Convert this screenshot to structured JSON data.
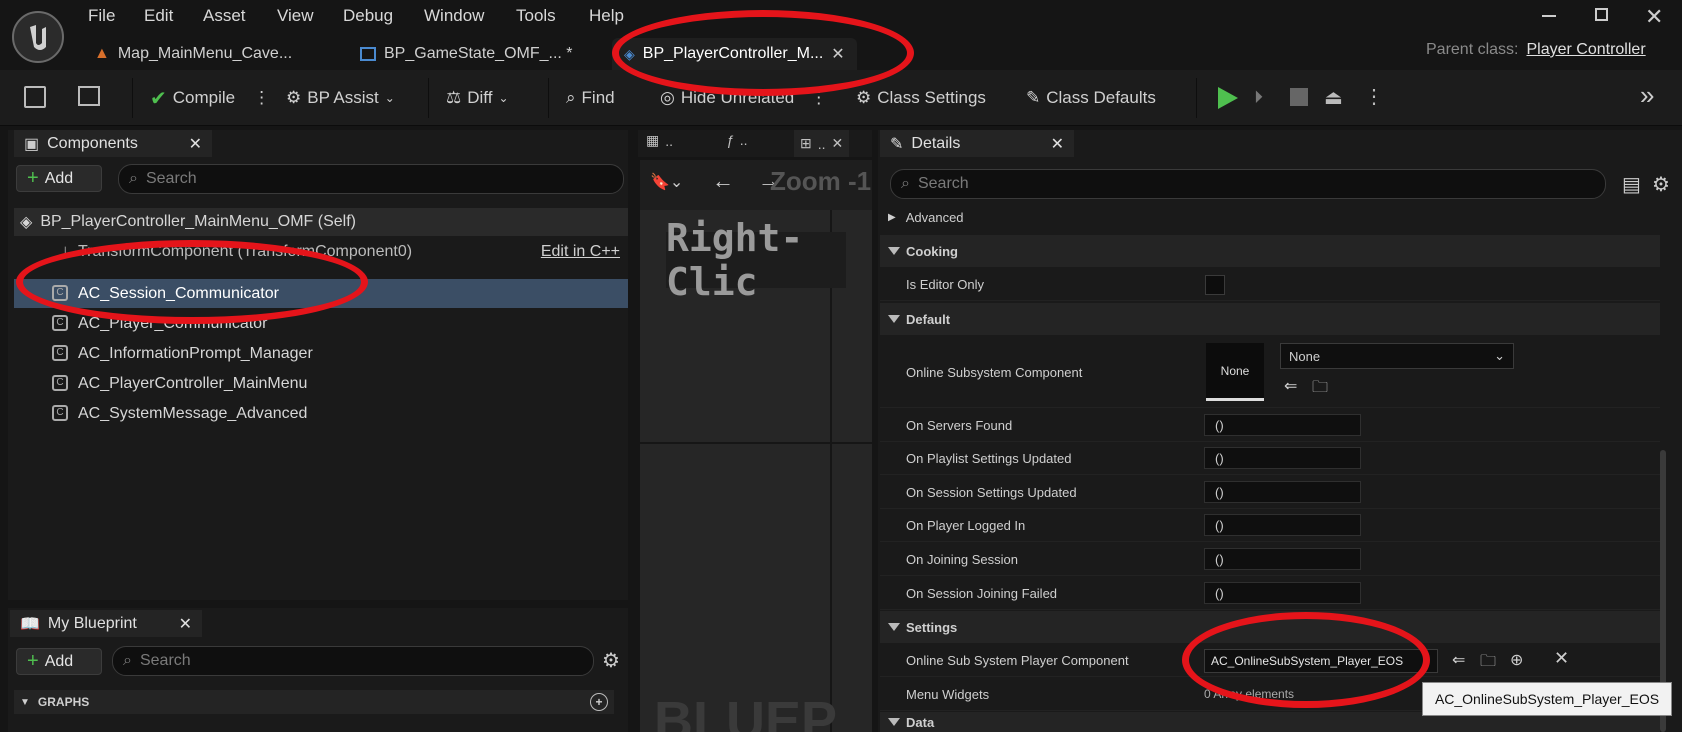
{
  "menu": [
    "File",
    "Edit",
    "Asset",
    "View",
    "Debug",
    "Window",
    "Tools",
    "Help"
  ],
  "tabs": [
    {
      "label": "Map_MainMenu_Cave..."
    },
    {
      "label": "BP_GameState_OMF_... *"
    },
    {
      "label": "BP_PlayerController_M..."
    }
  ],
  "parent_class": {
    "label": "Parent class:",
    "value": "Player Controller"
  },
  "toolbar": {
    "compile": "Compile",
    "bp_assist": "BP Assist",
    "diff": "Diff",
    "find": "Find",
    "hide_unrelated": "Hide Unrelated",
    "class_settings": "Class Settings",
    "class_defaults": "Class Defaults"
  },
  "components": {
    "title": "Components",
    "add": "Add",
    "search_placeholder": "Search",
    "self_label": "BP_PlayerController_MainMenu_OMF (Self)",
    "transform_label": "TransformComponent (TransformComponent0)",
    "edit_cpp": "Edit in C++",
    "items": [
      "AC_Session_Communicator",
      "AC_Player_Communicator",
      "AC_InformationPrompt_Manager",
      "AC_PlayerController_MainMenu",
      "AC_SystemMessage_Advanced"
    ]
  },
  "graph": {
    "tab1": "..",
    "tab2": "..",
    "tab3": "..",
    "zoom": "Zoom -1",
    "hint": "Right-Clic",
    "watermark": "BLUEP"
  },
  "my_blueprint": {
    "title": "My Blueprint",
    "add": "Add",
    "search_placeholder": "Search",
    "graphs": "GRAPHS"
  },
  "details": {
    "title": "Details",
    "search_placeholder": "Search",
    "advanced": "Advanced",
    "cooking": "Cooking",
    "is_editor_only": "Is Editor Only",
    "default": "Default",
    "online_subsystem_component": "Online Subsystem Component",
    "none_thumb": "None",
    "none_combo": "None",
    "events": [
      {
        "label": "On Servers Found",
        "value": "()"
      },
      {
        "label": "On Playlist Settings Updated",
        "value": "()"
      },
      {
        "label": "On Session Settings Updated",
        "value": "()"
      },
      {
        "label": "On Player Logged In",
        "value": "()"
      },
      {
        "label": "On Joining Session",
        "value": "()"
      },
      {
        "label": "On Session Joining Failed",
        "value": "()"
      }
    ],
    "settings": "Settings",
    "player_component_label": "Online Sub System Player Component",
    "player_component_value": "AC_OnlineSubSystem_Player_EOS",
    "menu_widgets_label": "Menu Widgets",
    "menu_widgets_value": "0 Array elements",
    "data": "Data",
    "tooltip": "AC_OnlineSubSystem_Player_EOS"
  }
}
